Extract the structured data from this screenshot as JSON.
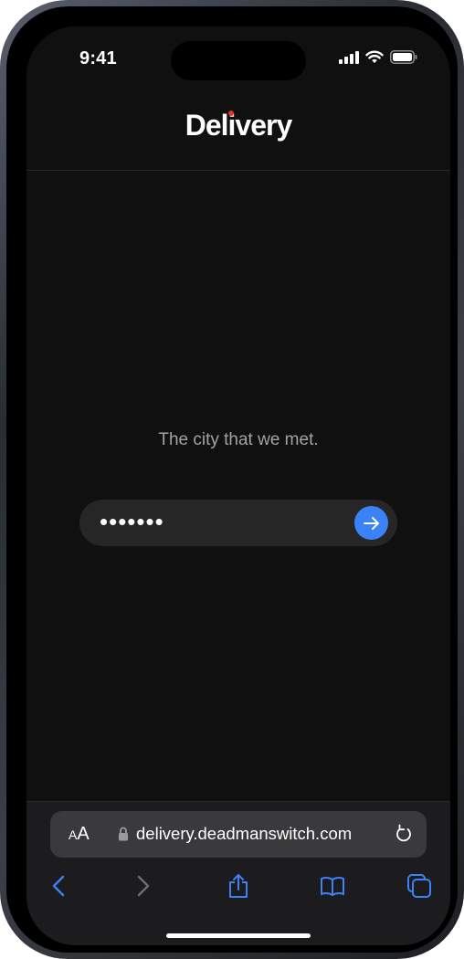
{
  "status_bar": {
    "time": "9:41"
  },
  "header": {
    "logo_text": "Delivery"
  },
  "main": {
    "prompt": "The city that we met.",
    "password_value": "•••••••"
  },
  "browser": {
    "text_size_label_small": "A",
    "text_size_label_large": "A",
    "url": "delivery.deadmanswitch.com"
  },
  "colors": {
    "accent": "#3b82f6",
    "logo_dot": "#e5332a",
    "background": "#101010",
    "field_bg": "#262626",
    "toolbar_bg": "#1c1c1e"
  },
  "icons": [
    "signal-icon",
    "wifi-icon",
    "battery-icon",
    "arrow-right-icon",
    "lock-icon",
    "reload-icon",
    "back-icon",
    "forward-icon",
    "share-icon",
    "bookmarks-icon",
    "tabs-icon"
  ]
}
